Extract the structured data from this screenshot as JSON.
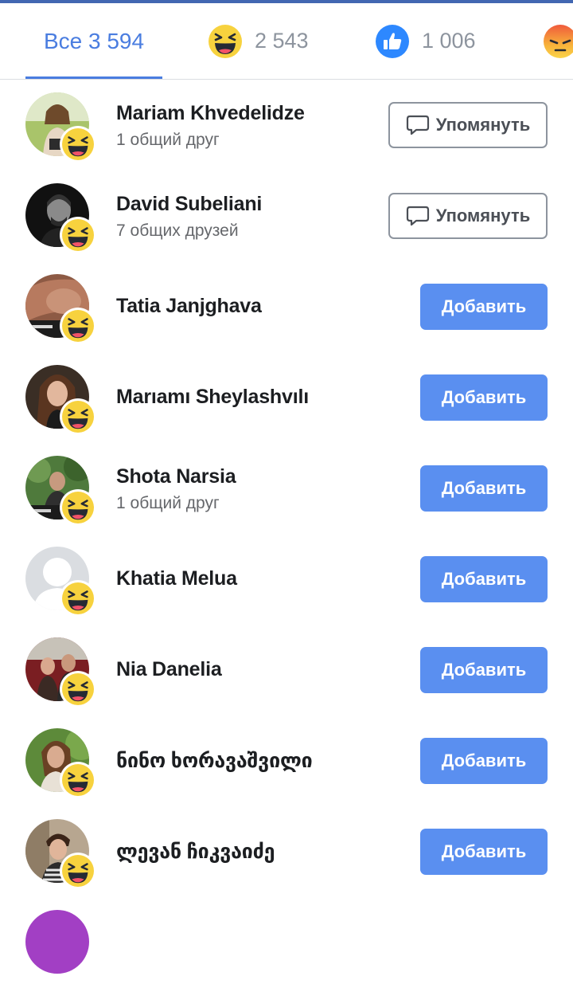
{
  "tabs": [
    {
      "label": "Все 3 594",
      "reaction": "all",
      "active": true
    },
    {
      "reaction": "haha-icon",
      "count": "2 543"
    },
    {
      "reaction": "like-icon",
      "count": "1 006"
    },
    {
      "reaction": "angry-icon"
    }
  ],
  "accent_color": "#4a7de0",
  "people": [
    {
      "name": "Mariam Khvedelidze",
      "subtitle": "1 общий друг",
      "action": "Упомянуть",
      "reaction": "haha-icon"
    },
    {
      "name": "David Subeliani",
      "subtitle": "7 общих друзей",
      "action": "Упомянуть",
      "reaction": "haha-icon"
    },
    {
      "name": "Tatia Janjghava",
      "action": "Добавить",
      "reaction": "haha-icon"
    },
    {
      "name": "Marıamı Sheylashvılı",
      "action": "Добавить",
      "reaction": "haha-icon"
    },
    {
      "name": "Shota Narsia",
      "subtitle": "1 общий друг",
      "action": "Добавить",
      "reaction": "haha-icon"
    },
    {
      "name": "Khatia Melua",
      "action": "Добавить",
      "reaction": "haha-icon"
    },
    {
      "name": "Nia Danelia",
      "action": "Добавить",
      "reaction": "haha-icon"
    },
    {
      "name": "ნინო ხორავაშვილი",
      "action": "Добавить",
      "reaction": "haha-icon"
    },
    {
      "name": "ლევან ჩიკვაიძე",
      "action": "Добавить",
      "reaction": "haha-icon"
    }
  ]
}
